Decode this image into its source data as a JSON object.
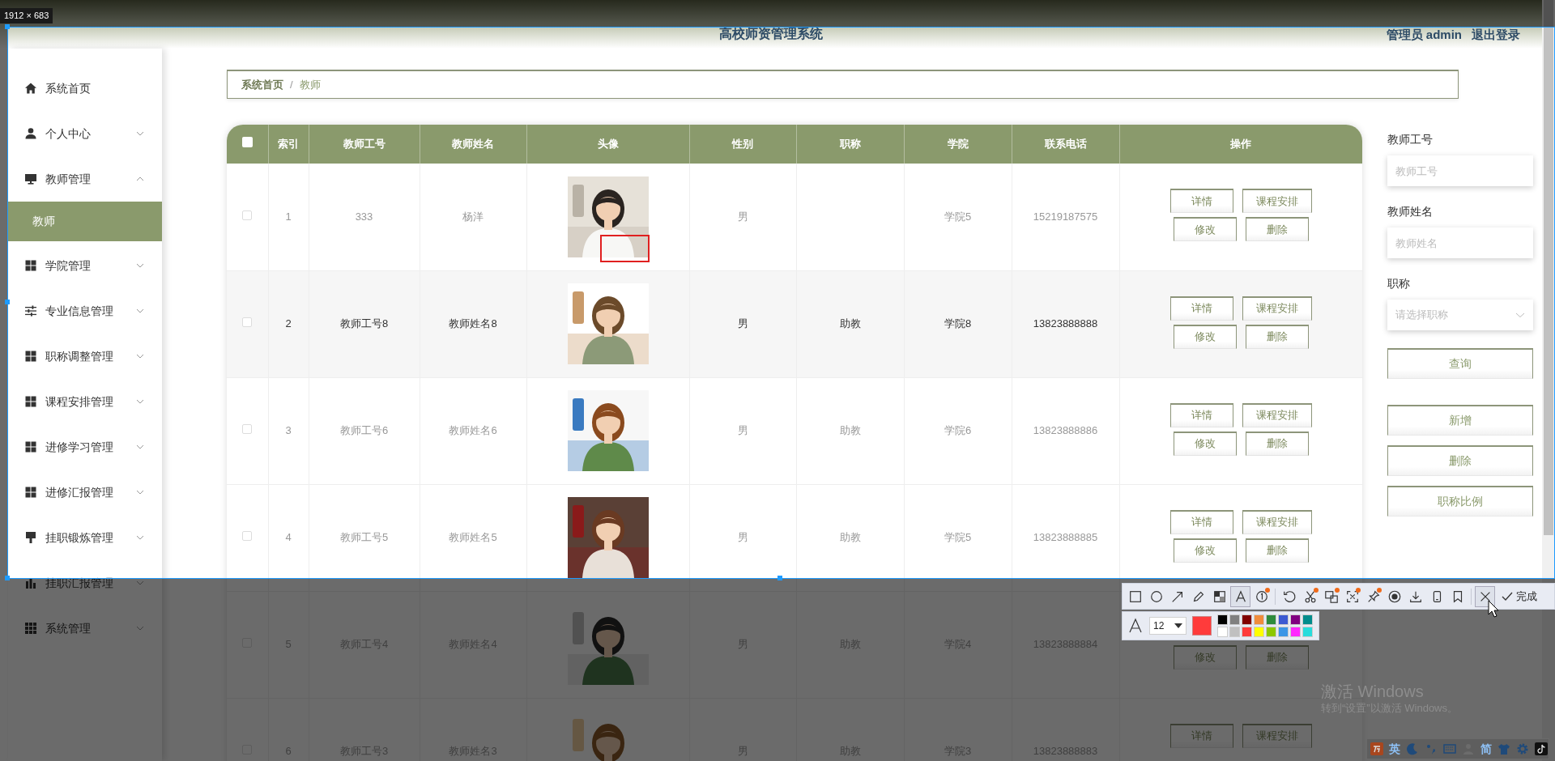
{
  "size_label": "1912 × 683",
  "header": {
    "title": "高校师资管理系统",
    "user": "管理员 admin",
    "logout": "退出登录"
  },
  "sidebar": {
    "items": [
      {
        "label": "系统首页"
      },
      {
        "label": "个人中心",
        "expanded": false
      },
      {
        "label": "教师管理",
        "expanded": true,
        "children": [
          {
            "label": "教师",
            "selected": true
          }
        ]
      },
      {
        "label": "学院管理",
        "expanded": false
      },
      {
        "label": "专业信息管理",
        "expanded": false
      },
      {
        "label": "职称调整管理",
        "expanded": false
      },
      {
        "label": "课程安排管理",
        "expanded": false
      },
      {
        "label": "进修学习管理",
        "expanded": false
      },
      {
        "label": "进修汇报管理",
        "expanded": false
      },
      {
        "label": "挂职锻炼管理",
        "expanded": false
      },
      {
        "label": "挂职汇报管理",
        "expanded": false
      },
      {
        "label": "系统管理",
        "expanded": false
      }
    ]
  },
  "breadcrumb": {
    "items": [
      "系统首页",
      "教师"
    ],
    "separator": "/"
  },
  "table": {
    "all_checked": false,
    "columns": [
      "索引",
      "教师工号",
      "教师姓名",
      "头像",
      "性别",
      "职称",
      "学院",
      "联系电话",
      "操作"
    ],
    "rows": [
      {
        "index": "1",
        "teacher_id": "333",
        "name": "杨洋",
        "avatar": {
          "kind": "picture"
        },
        "gender": "男",
        "college": "学院5",
        "phone": "15219187575",
        "checked": false,
        "highlighted": false,
        "actions_top": [
          "详情",
          "课程安排"
        ],
        "actions_bottom": [
          "修改",
          "删除"
        ]
      },
      {
        "index": "2",
        "teacher_id": "教师工号8",
        "name": "教师姓名8",
        "avatar": {
          "kind": "picture"
        },
        "gender": "男",
        "title": "助教",
        "college": "学院8",
        "phone": "13823888888",
        "checked": false,
        "highlighted": true,
        "actions_top": [
          "详情",
          "课程安排"
        ],
        "actions_bottom": [
          "修改",
          "删除"
        ]
      },
      {
        "index": "3",
        "teacher_id": "教师工号6",
        "name": "教师姓名6",
        "avatar": {
          "kind": "picture"
        },
        "gender": "男",
        "title": "助教",
        "college": "学院6",
        "phone": "13823888886",
        "checked": false,
        "highlighted": false,
        "actions_top": [
          "详情",
          "课程安排"
        ],
        "actions_bottom": [
          "修改",
          "删除"
        ]
      },
      {
        "index": "4",
        "teacher_id": "教师工号5",
        "name": "教师姓名5",
        "avatar": {
          "kind": "picture"
        },
        "gender": "男",
        "title": "助教",
        "college": "学院5",
        "phone": "13823888885",
        "checked": false,
        "highlighted": false,
        "actions_top": [
          "详情",
          "课程安排"
        ],
        "actions_bottom": [
          "修改",
          "删除"
        ]
      },
      {
        "index": "5",
        "teacher_id": "教师工号4",
        "name": "教师姓名4",
        "avatar": {
          "kind": "picture"
        },
        "gender": "男",
        "title": "助教",
        "college": "学院4",
        "phone": "13823888884",
        "checked": false,
        "highlighted": false,
        "actions_bottom": [
          "修改",
          "删除"
        ]
      },
      {
        "index": "6",
        "teacher_id": "教师工号3",
        "name": "教师姓名3",
        "avatar": {
          "kind": "picture"
        },
        "gender": "男",
        "title": "助教",
        "college": "学院3",
        "phone": "13823888883",
        "checked": false,
        "highlighted": false,
        "actions_top": [
          "详情",
          "课程安排"
        ]
      }
    ]
  },
  "search": {
    "fields": [
      {
        "kind": "text",
        "label": "教师工号",
        "placeholder": "教师工号"
      },
      {
        "kind": "text",
        "label": "教师姓名",
        "placeholder": "教师姓名"
      },
      {
        "kind": "select",
        "label": "职称",
        "placeholder": "请选择职称"
      }
    ],
    "query_button": "查询",
    "actions": [
      "新增",
      "删除",
      "职称比例"
    ]
  },
  "capture_toolbar": {
    "tool_groups": [
      [
        {
          "selected": false,
          "dot": false
        },
        {
          "selected": false,
          "dot": false
        },
        {
          "selected": false,
          "dot": false
        },
        {
          "selected": false,
          "dot": false
        },
        {
          "selected": false,
          "dot": false
        },
        {
          "selected": true,
          "dot": false
        },
        {
          "selected": false,
          "dot": true
        }
      ],
      [
        {
          "selected": false,
          "dot": false
        },
        {
          "selected": false,
          "dot": true
        },
        {
          "selected": false,
          "dot": true
        },
        {
          "selected": false,
          "dot": true
        },
        {
          "selected": false,
          "dot": true
        },
        {
          "selected": false,
          "dot": false
        },
        {
          "selected": false,
          "dot": false
        },
        {
          "selected": false,
          "dot": false
        },
        {
          "selected": false,
          "dot": false
        }
      ],
      [
        {
          "selected": true,
          "dot": false
        }
      ]
    ],
    "done": "完成"
  },
  "text_options": {
    "font_size": "12",
    "current_swatch": {
      "color": "#ff3b3b"
    },
    "colors": [
      {
        "color": "#000000"
      },
      {
        "color": "#808080"
      },
      {
        "color": "#800000"
      },
      {
        "color": "#f08c3c"
      },
      {
        "color": "#2e8b3c"
      },
      {
        "color": "#3c5ad2"
      },
      {
        "color": "#800080"
      },
      {
        "color": "#008c8c"
      },
      {
        "color": "#ffffff"
      },
      {
        "color": "#c0c0c0"
      },
      {
        "color": "#ff3b3b"
      },
      {
        "color": "#ffff00"
      },
      {
        "color": "#8cc800"
      },
      {
        "color": "#3c96e6"
      },
      {
        "color": "#ff28ff"
      },
      {
        "color": "#28dcdc"
      }
    ]
  },
  "activation": {
    "title": "激活 Windows",
    "text": "转到“设置”以激活 Windows。"
  },
  "tray": {
    "language": "英",
    "script": "简"
  }
}
